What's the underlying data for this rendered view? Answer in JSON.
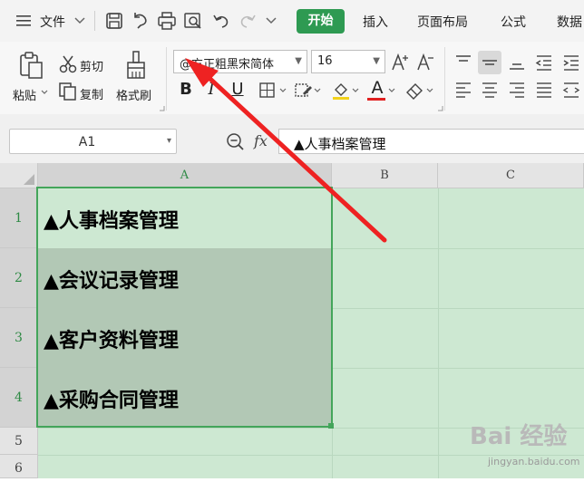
{
  "menubar": {
    "file_label": "文件",
    "tabs": [
      {
        "label": "开始",
        "active": true
      },
      {
        "label": "插入"
      },
      {
        "label": "页面布局"
      },
      {
        "label": "公式"
      },
      {
        "label": "数据"
      }
    ],
    "icons": [
      "hamburger-menu-icon",
      "save-icon",
      "undo-history-icon",
      "print-icon",
      "print-preview-icon",
      "undo-icon",
      "redo-icon"
    ]
  },
  "ribbon": {
    "paste_label": "粘贴",
    "cut_label": "剪切",
    "copy_label": "复制",
    "format_painter_label": "格式刷",
    "font_name": "@方正粗黑宋简体",
    "font_size": "16",
    "bold": "B",
    "italic": "I",
    "underline": "U",
    "font_color_glyph": "A"
  },
  "formula_bar": {
    "name_box": "A1",
    "fx_label": "fx",
    "content": "▲人事档案管理"
  },
  "sheet": {
    "columns": [
      "A",
      "B",
      "C"
    ],
    "rows": [
      "1",
      "2",
      "3",
      "4",
      "5",
      "6"
    ],
    "cells": [
      "▲人事档案管理",
      "▲会议记录管理",
      "▲客户资料管理",
      "▲采购合同管理"
    ]
  },
  "colors": {
    "accent": "#2e9a52",
    "grid_background": "#cde8d2",
    "selection_border": "#43a55a",
    "arrow": "#ee2222"
  },
  "watermark": {
    "logo": "Bai 经验",
    "url": "jingyan.baidu.com"
  }
}
